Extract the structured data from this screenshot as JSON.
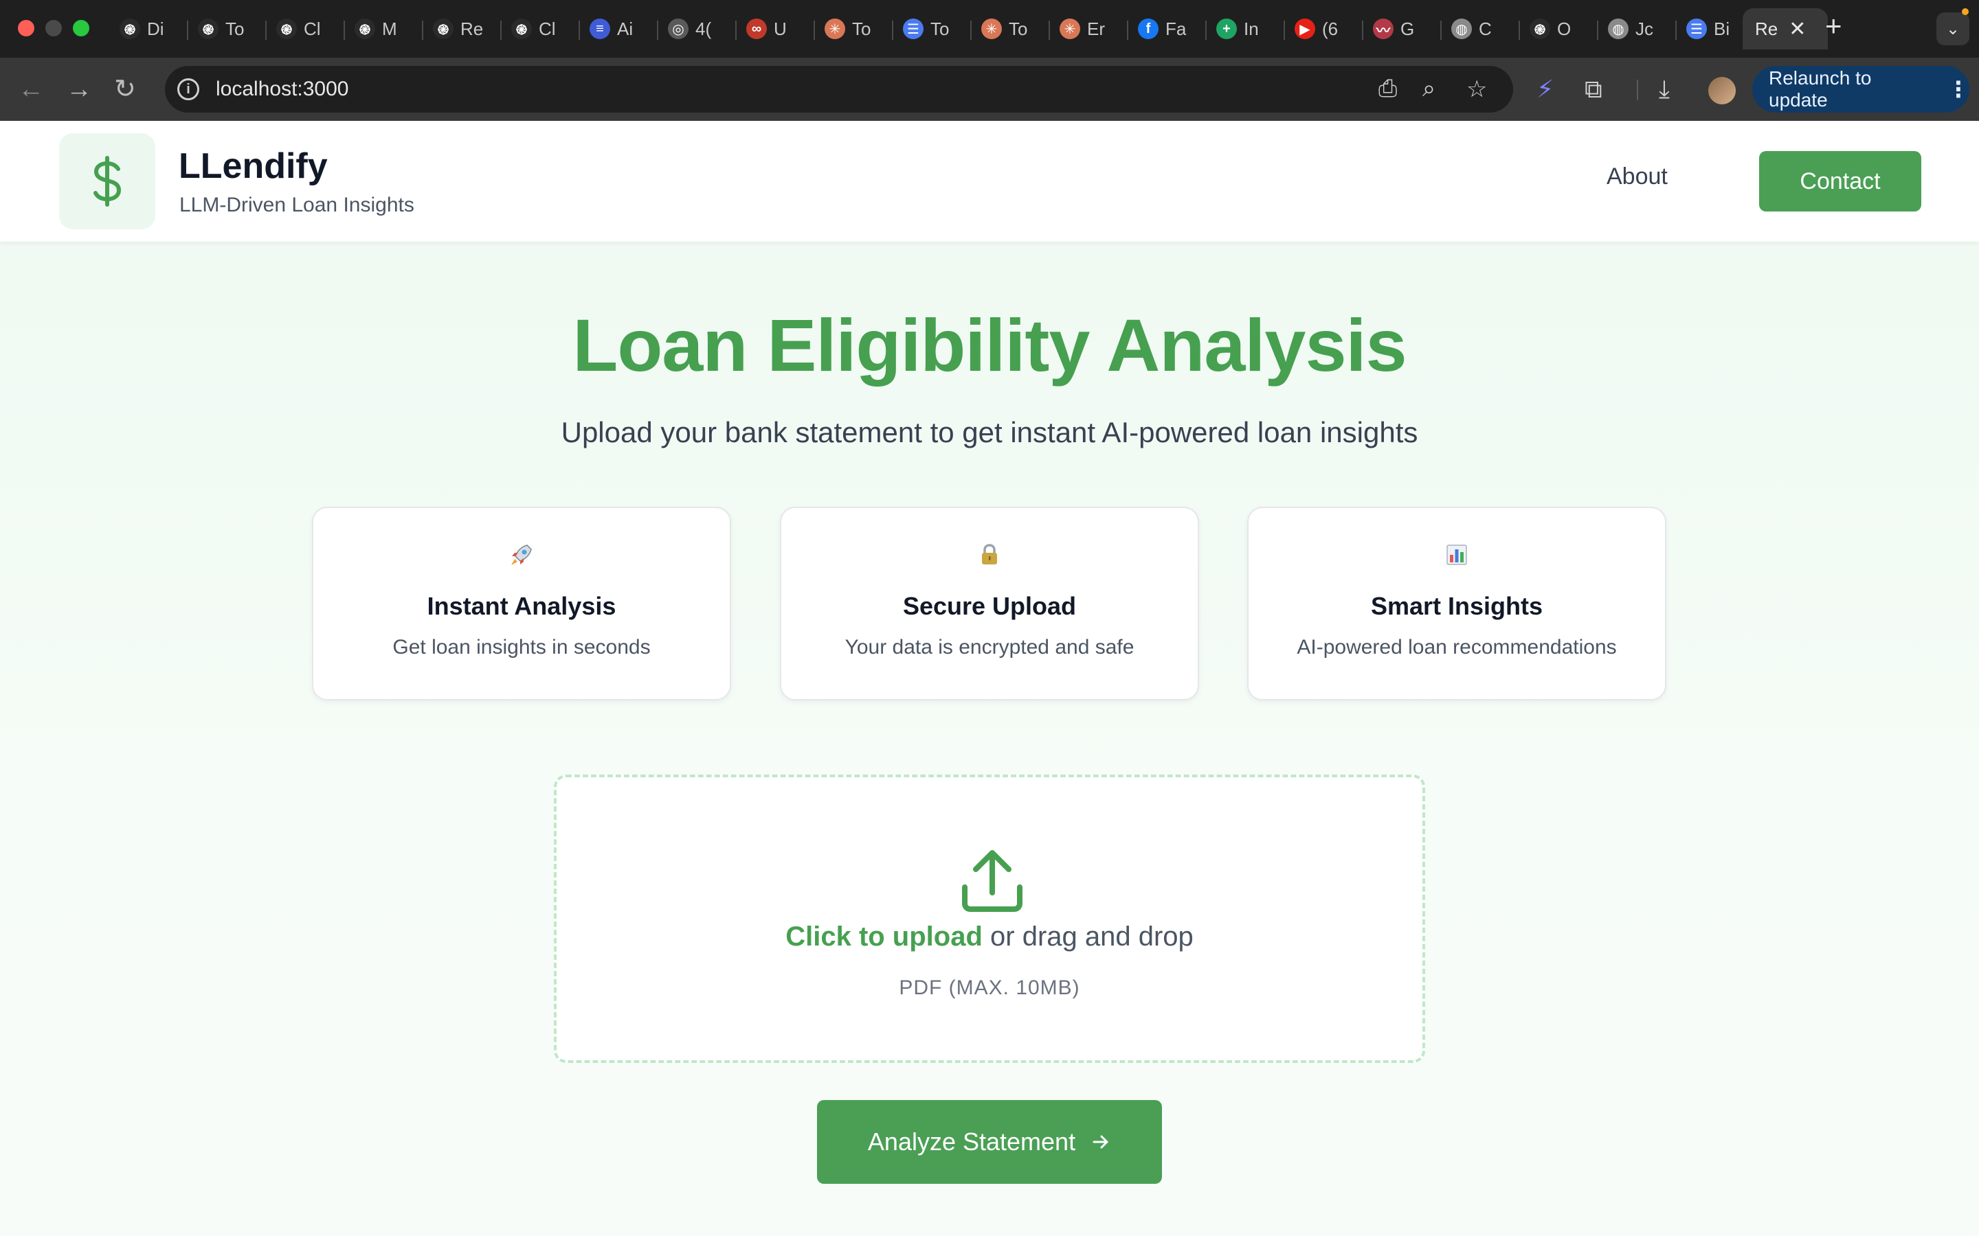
{
  "browser": {
    "tabs": [
      {
        "label": "Di",
        "icon": "openai-icon",
        "color": "#2b2b2b"
      },
      {
        "label": "To",
        "icon": "openai-icon",
        "color": "#2b2b2b"
      },
      {
        "label": "Cl",
        "icon": "openai-icon",
        "color": "#2b2b2b"
      },
      {
        "label": "M",
        "icon": "openai-icon",
        "color": "#2b2b2b"
      },
      {
        "label": "Re",
        "icon": "openai-icon",
        "color": "#2b2b2b"
      },
      {
        "label": "Cl",
        "icon": "openai-icon",
        "color": "#2b2b2b"
      },
      {
        "label": "Ai",
        "icon": "list-icon",
        "color": "#3f5bd6"
      },
      {
        "label": "4(",
        "icon": "spiral-icon",
        "color": "#5a5a5a"
      },
      {
        "label": "U",
        "icon": "infinity-icon",
        "color": "#c0392b"
      },
      {
        "label": "To",
        "icon": "sparkle-icon",
        "color": "#d97757"
      },
      {
        "label": "To",
        "icon": "docs-icon",
        "color": "#4a7bf0"
      },
      {
        "label": "To",
        "icon": "sparkle-icon",
        "color": "#d97757"
      },
      {
        "label": "Er",
        "icon": "sparkle-icon",
        "color": "#d97757"
      },
      {
        "label": "Fa",
        "icon": "facebook-icon",
        "color": "#1877f2"
      },
      {
        "label": "In",
        "icon": "sheets-icon",
        "color": "#1fa463"
      },
      {
        "label": "(6",
        "icon": "youtube-icon",
        "color": "#e62117"
      },
      {
        "label": "G",
        "icon": "chart-icon",
        "color": "#b23a48"
      },
      {
        "label": "C",
        "icon": "globe-icon",
        "color": "#8a8a8a"
      },
      {
        "label": "O",
        "icon": "openai-icon",
        "color": "#2b2b2b"
      },
      {
        "label": "Jc",
        "icon": "globe-icon",
        "color": "#8a8a8a"
      },
      {
        "label": "Bi",
        "icon": "docs-icon",
        "color": "#4a7bf0"
      }
    ],
    "active_tab": {
      "label": "Re"
    },
    "url": "localhost:3000",
    "relaunch_label": "Relaunch to update"
  },
  "header": {
    "brand": "LLendify",
    "tagline": "LLM-Driven Loan Insights",
    "nav_about": "About",
    "contact_label": "Contact"
  },
  "hero": {
    "title": "Loan Eligibility Analysis",
    "subtitle": "Upload your bank statement to get instant AI-powered loan insights"
  },
  "features": [
    {
      "icon": "rocket-icon",
      "title": "Instant Analysis",
      "desc": "Get loan insights in seconds"
    },
    {
      "icon": "lock-icon",
      "title": "Secure Upload",
      "desc": "Your data is encrypted and safe"
    },
    {
      "icon": "bar-chart-icon",
      "title": "Smart Insights",
      "desc": "AI-powered loan recommendations"
    }
  ],
  "upload": {
    "link_text": "Click to upload",
    "rest_text": " or drag and drop",
    "hint": "PDF (MAX. 10MB)"
  },
  "analyze_label": "Analyze Statement",
  "colors": {
    "brand_green": "#46a050",
    "button_green": "#4a9f55",
    "page_bg": "#f3fbf5"
  }
}
